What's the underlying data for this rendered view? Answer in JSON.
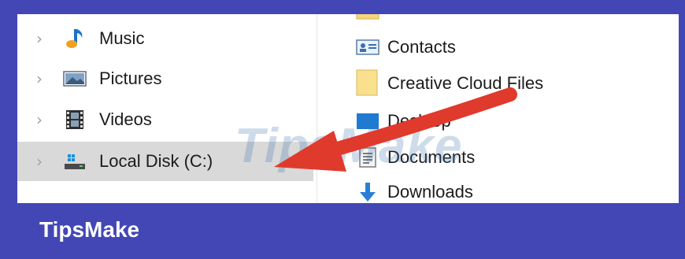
{
  "nav": {
    "items": [
      {
        "label": "Music",
        "icon": "music-note-icon"
      },
      {
        "label": "Pictures",
        "icon": "pictures-icon"
      },
      {
        "label": "Videos",
        "icon": "videos-icon"
      },
      {
        "label": "Local Disk (C:)",
        "icon": "local-disk-icon",
        "selected": true
      }
    ]
  },
  "files": {
    "items": [
      {
        "label": "Contacts",
        "icon": "contacts-icon"
      },
      {
        "label": "Creative Cloud Files",
        "icon": "folder-icon"
      },
      {
        "label": "Desktop",
        "icon": "desktop-icon"
      },
      {
        "label": "Documents",
        "icon": "documents-icon"
      },
      {
        "label": "Downloads",
        "icon": "downloads-icon"
      }
    ]
  },
  "watermark": "TipsMake",
  "footer": {
    "brand": "TipsMake"
  },
  "colors": {
    "frame": "#4347b5",
    "arrow": "#e03a2c",
    "selected_row": "#d9d9d9"
  }
}
